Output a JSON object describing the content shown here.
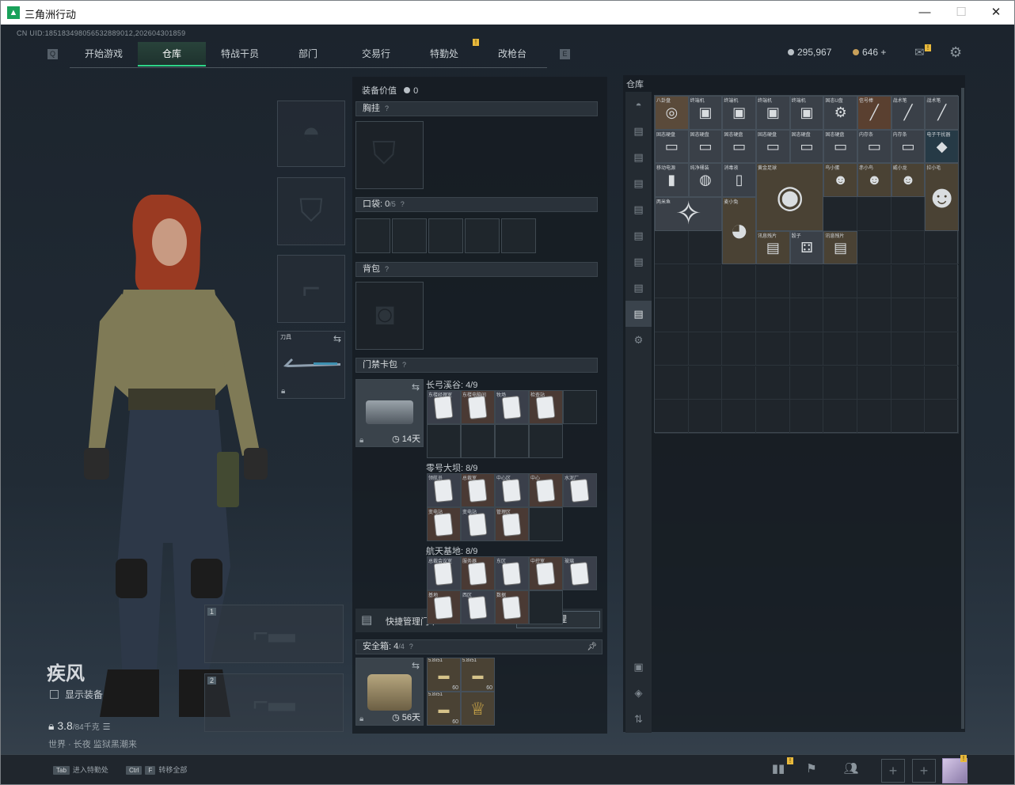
{
  "window": {
    "title": "三角洲行动",
    "min": "—",
    "max": "☐",
    "close": "✕"
  },
  "uid_text": "CN UID:185183498056532889012,202604301859",
  "nav": {
    "tabs": [
      "开始游戏",
      "仓库",
      "特战干员",
      "部门",
      "交易行",
      "特勤处",
      "改枪台"
    ],
    "active": "仓库",
    "left_key": "Q",
    "right_key": "E",
    "badge": "!"
  },
  "currency": {
    "silver": "295,967",
    "gold": "646",
    "plus": "+",
    "mail_badge": "!"
  },
  "character": {
    "name": "疾风",
    "show_equipment": "显示装备",
    "weight": "3.8",
    "weight_unit": "/84千克",
    "map_text": "世界 · 长夜 监狱黑潮来"
  },
  "gear_slots": {
    "melee_label": "刀具",
    "weapon1": "1",
    "weapon2": "2"
  },
  "equipment": {
    "value_label": "装备价值",
    "value": "0",
    "chest_rig": "胸挂",
    "pockets": "口袋:",
    "pockets_count": "0",
    "pockets_max": "/5",
    "backpack": "背包",
    "keycard_bag": "门禁卡包",
    "keycard_days": "14天",
    "help": "?",
    "maps": [
      {
        "name": "长弓溪谷:",
        "count": "4/9",
        "cards": [
          "东楼经理室",
          "东楼电脑间",
          "牧场",
          "检查站"
        ]
      },
      {
        "name": "零号大坝:",
        "count": "8/9",
        "cards": [
          "领航员",
          "总裁室",
          "中心区",
          "中心",
          "水泥厂",
          "变电站",
          "变电站",
          "管理区"
        ]
      },
      {
        "name": "航天基地:",
        "count": "8/9",
        "cards": [
          "总裁会议室",
          "服务器",
          "东区",
          "中控室",
          "玻璃",
          "基地",
          "西区",
          "数据"
        ]
      }
    ],
    "quick_manage": "快捷管理门卡",
    "manage_btn": "管理",
    "safe_box": "安全箱:",
    "safe_count": "4",
    "safe_max": "/4",
    "safe_days": "56天",
    "safe_items": [
      "5.8x51",
      "5.8x51",
      "5.8x51",
      "金杯"
    ],
    "ammo_count": "60"
  },
  "inventory": {
    "title": "仓库",
    "items": [
      {
        "label": "八卦盘",
        "glyph": "◎",
        "color": "#5a4a3a"
      },
      {
        "label": "终端机",
        "glyph": "▣",
        "color": "#3a4048"
      },
      {
        "label": "终端机",
        "glyph": "▣",
        "color": "#3a4048"
      },
      {
        "label": "终端机",
        "glyph": "▣",
        "color": "#3a4048"
      },
      {
        "label": "终端机",
        "glyph": "▣",
        "color": "#3a4048"
      },
      {
        "label": "固态U盘",
        "glyph": "⚙",
        "color": "#3a4048"
      },
      {
        "label": "信号棒",
        "glyph": "╱",
        "color": "#5a4030"
      },
      {
        "label": "战术笔",
        "glyph": "╱",
        "color": "#3a4048"
      },
      {
        "label": "战术笔",
        "glyph": "╱",
        "color": "#3a4048"
      },
      {
        "label": "固态硬盘",
        "glyph": "▭",
        "color": "#3a4048"
      },
      {
        "label": "固态硬盘",
        "glyph": "▭",
        "color": "#3a4048"
      },
      {
        "label": "固态硬盘",
        "glyph": "▭",
        "color": "#3a4048"
      },
      {
        "label": "固态硬盘",
        "glyph": "▭",
        "color": "#3a4048"
      },
      {
        "label": "固态硬盘",
        "glyph": "▭",
        "color": "#3a4048"
      },
      {
        "label": "固态硬盘",
        "glyph": "▭",
        "color": "#3a4048"
      },
      {
        "label": "内存条",
        "glyph": "▭",
        "color": "#3a4048"
      },
      {
        "label": "内存条",
        "glyph": "▭",
        "color": "#3a4048"
      },
      {
        "label": "电子干扰器",
        "glyph": "◆",
        "color": "#263a46"
      },
      {
        "label": "移动电源",
        "glyph": "▮",
        "color": "#3a4048"
      },
      {
        "label": "纯净桶装",
        "glyph": "◍",
        "color": "#3a4048"
      },
      {
        "label": "消毒液",
        "glyph": "▯",
        "color": "#3a4048"
      },
      {
        "label": "黄金足球",
        "glyph": "◉",
        "color": "#4a4234"
      },
      {
        "label": "鸟小蛋",
        "glyph": "☻",
        "color": "#4a4234"
      },
      {
        "label": "赤小鸟",
        "glyph": "☻",
        "color": "#4a4234"
      },
      {
        "label": "威小龙",
        "glyph": "☻",
        "color": "#4a4234"
      },
      {
        "label": "拉小毛",
        "glyph": "☻",
        "color": "#4a4234"
      },
      {
        "label": "两米鱼",
        "glyph": "✧",
        "color": "#3a4048"
      },
      {
        "label": "美小莉",
        "glyph": "☻",
        "color": "#4a4234"
      },
      {
        "label": "麦小兔",
        "glyph": "◕",
        "color": "#4a4234"
      },
      {
        "label": "讯息残片",
        "glyph": "▤",
        "color": "#4a4234"
      },
      {
        "label": "骰子",
        "glyph": "⚃",
        "color": "#3a4048"
      },
      {
        "label": "讯息残片",
        "glyph": "▤",
        "color": "#4a4234"
      }
    ]
  },
  "bottom": {
    "hint1_key": "Tab",
    "hint1": "进入特勤处",
    "hint2_key1": "Ctrl",
    "hint2_key2": "F",
    "hint2": "转移全部",
    "badge": "!",
    "plus": "+"
  }
}
